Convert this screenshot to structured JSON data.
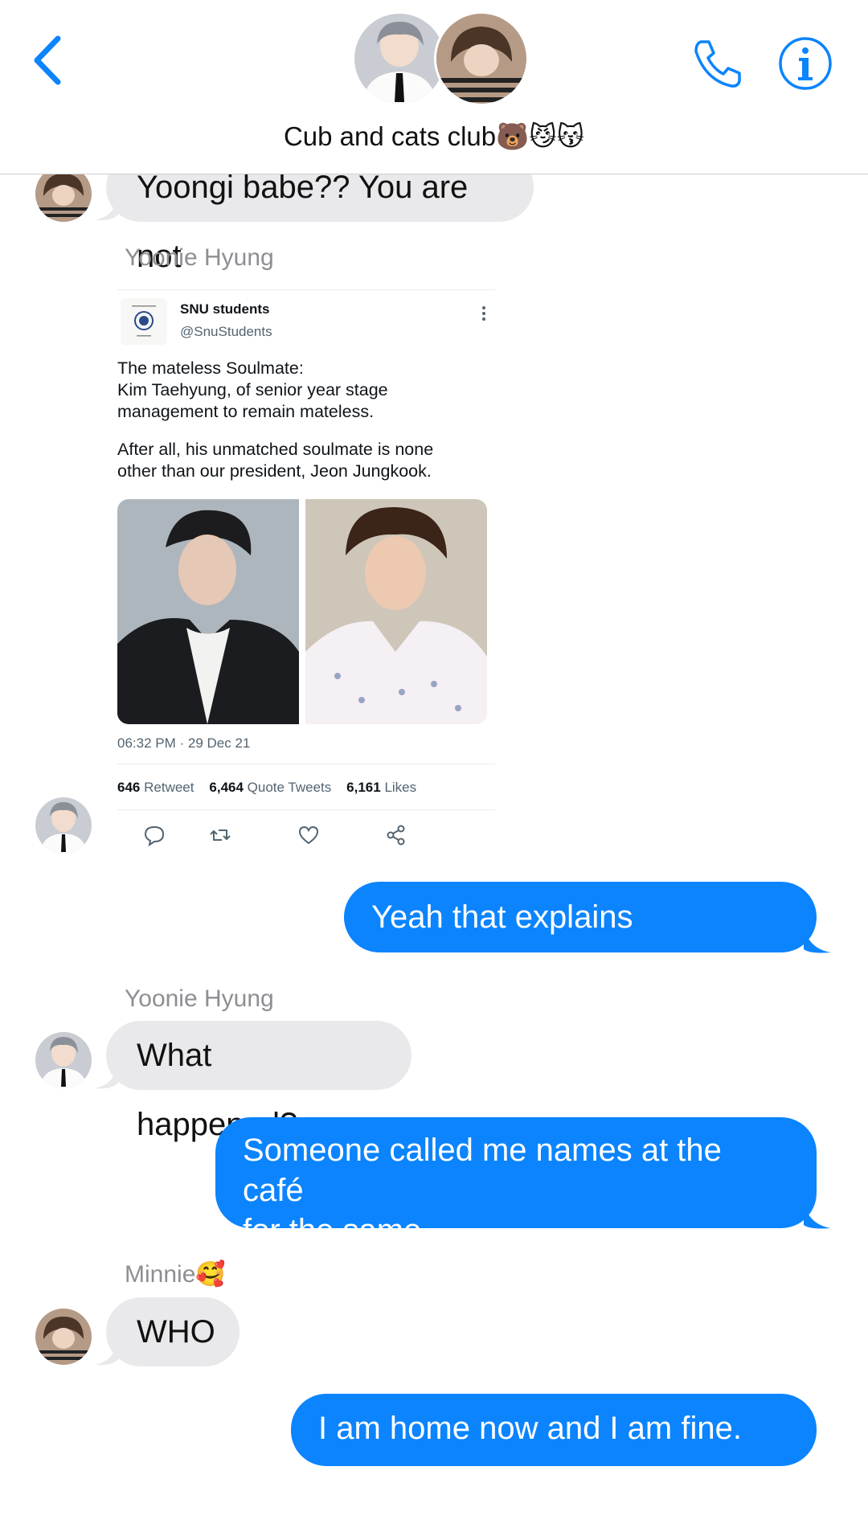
{
  "header": {
    "group_name": "Cub and cats club🐻😼😽",
    "back_label": "Back",
    "call_icon": "phone-icon",
    "info_icon": "info-icon"
  },
  "colors": {
    "accent": "#0b84fe",
    "incoming_bubble": "#e9e9eb",
    "sender_name": "#8e8e93"
  },
  "messages": {
    "m1": {
      "text": "Yoongi babe?? You are not"
    },
    "m2": {
      "sender": "Yoonie Hyung"
    },
    "m3": {
      "text": "Yeah that explains everything"
    },
    "m4": {
      "sender": "Yoonie Hyung",
      "text": "What happened?"
    },
    "m5": {
      "line1": "Someone called me names at the café",
      "line2": "for the same"
    },
    "m6": {
      "sender": "Minnie🥰",
      "text": "WHO"
    },
    "m7": {
      "text": "I am home now and I am fine. Gtg"
    }
  },
  "tweet": {
    "name": "SNU students",
    "handle": "@SnuStudents",
    "body_line1": "The mateless Soulmate:",
    "body_line2": "Kim Taehyung, of senior year stage",
    "body_line3": "management to remain mateless.",
    "body_line4": "After all, his unmatched soulmate is none",
    "body_line5": "other than our president, Jeon Jungkook.",
    "timestamp": "06:32 PM · 29 Dec 21",
    "retweets": "646",
    "retweets_label": "Retweet",
    "quotes": "6,464",
    "quotes_label": "Quote Tweets",
    "likes": "6,161",
    "likes_label": "Likes"
  }
}
